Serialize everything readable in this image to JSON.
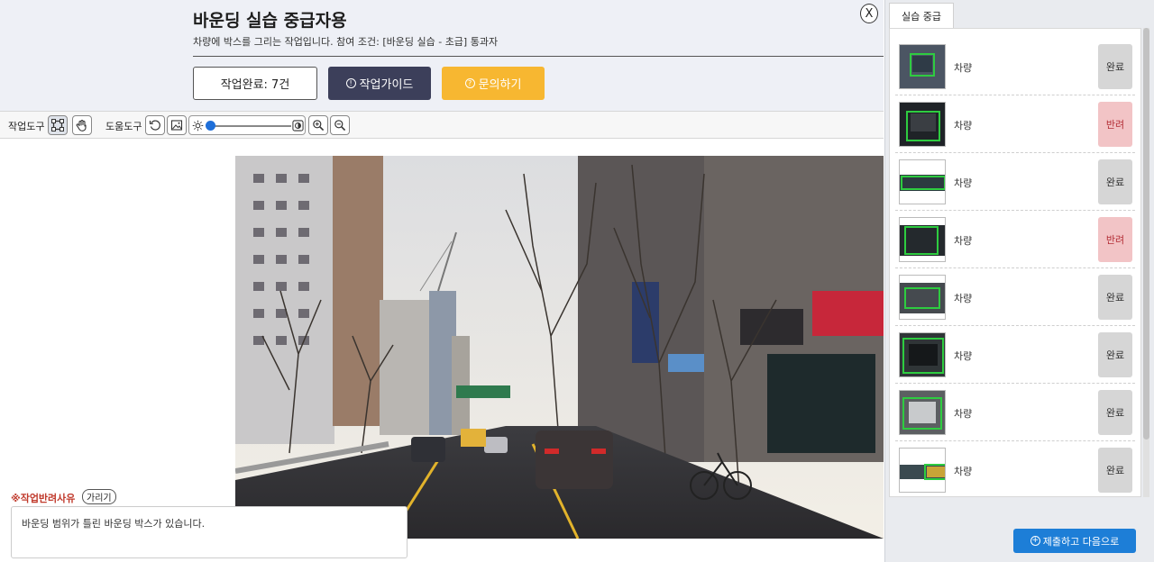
{
  "header": {
    "title": "바운딩 실습 중급자용",
    "description": "차량에 박스를 그리는 작업입니다. 참여 조건: [바운딩 실습 - 초급] 통과자",
    "close_label": "X",
    "done_button": "작업완료: 7건",
    "guide_button": "작업가이드",
    "ask_button": "문의하기",
    "info_glyph": "!",
    "question_glyph": "?"
  },
  "toolbar": {
    "work_tools_label": "작업도구",
    "help_tools_label": "도움도구"
  },
  "reason": {
    "label": "※작업반려사유",
    "hide_button": "가리기",
    "text": "바운딩 범위가 틀린 바운딩 박스가 있습니다."
  },
  "side": {
    "tab_label": "실습 중급",
    "items": [
      {
        "label": "차량",
        "status": "완료",
        "state": "done"
      },
      {
        "label": "차량",
        "status": "반려",
        "state": "reject"
      },
      {
        "label": "차량",
        "status": "완료",
        "state": "done"
      },
      {
        "label": "차량",
        "status": "반려",
        "state": "reject"
      },
      {
        "label": "차량",
        "status": "완료",
        "state": "done"
      },
      {
        "label": "차량",
        "status": "완료",
        "state": "done"
      },
      {
        "label": "차량",
        "status": "완료",
        "state": "done"
      },
      {
        "label": "차량",
        "status": "완료",
        "state": "done"
      }
    ],
    "submit_button": "제출하고 다음으로",
    "plus_glyph": "+"
  },
  "colors": {
    "accent": "#1d7ed7",
    "guide": "#3c3f5a",
    "ask": "#f7b731",
    "reject_bg": "#f2c4c6",
    "done_bg": "#d6d6d6",
    "bbox": "#2ecc40"
  }
}
